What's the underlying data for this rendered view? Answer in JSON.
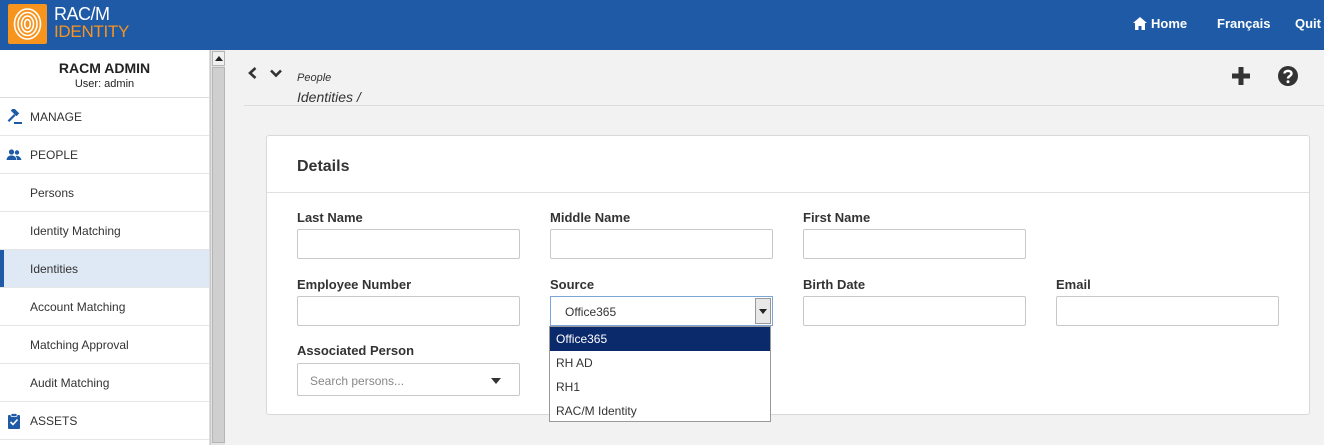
{
  "brand": {
    "line1": "RAC/M",
    "line2": "IDENTITY"
  },
  "topnav": {
    "home": "Home",
    "language": "Français",
    "quit": "Quit"
  },
  "sidebar": {
    "admin_title": "RACM ADMIN",
    "admin_user": "User: admin",
    "sections": [
      {
        "label": "MANAGE",
        "icon": "gavel-icon"
      },
      {
        "label": "PEOPLE",
        "icon": "people-icon"
      },
      {
        "label": "ASSETS",
        "icon": "clipboard-check-icon"
      }
    ],
    "items": [
      {
        "label": "Persons"
      },
      {
        "label": "Identity Matching"
      },
      {
        "label": "Identities"
      },
      {
        "label": "Account Matching"
      },
      {
        "label": "Matching Approval"
      },
      {
        "label": "Audit Matching"
      }
    ],
    "active_item": "Identities"
  },
  "breadcrumb": {
    "parent": "People",
    "current": "Identities /"
  },
  "panel": {
    "title": "Details",
    "fields": {
      "last_name": {
        "label": "Last Name",
        "value": ""
      },
      "middle_name": {
        "label": "Middle Name",
        "value": ""
      },
      "first_name": {
        "label": "First Name",
        "value": ""
      },
      "employee_number": {
        "label": "Employee Number",
        "value": ""
      },
      "source": {
        "label": "Source",
        "value": "Office365"
      },
      "birth_date": {
        "label": "Birth Date",
        "value": ""
      },
      "email": {
        "label": "Email",
        "value": ""
      },
      "associated_person": {
        "label": "Associated Person",
        "placeholder": "Search persons..."
      }
    },
    "source_options": [
      "Office365",
      "RH AD",
      "RH1",
      "RAC/M Identity"
    ]
  },
  "colors": {
    "topbar": "#1f5aa6",
    "brand_accent": "#f7941d",
    "selected_option": "#0b2a6b",
    "active_item_bg": "#dfe8f5"
  }
}
